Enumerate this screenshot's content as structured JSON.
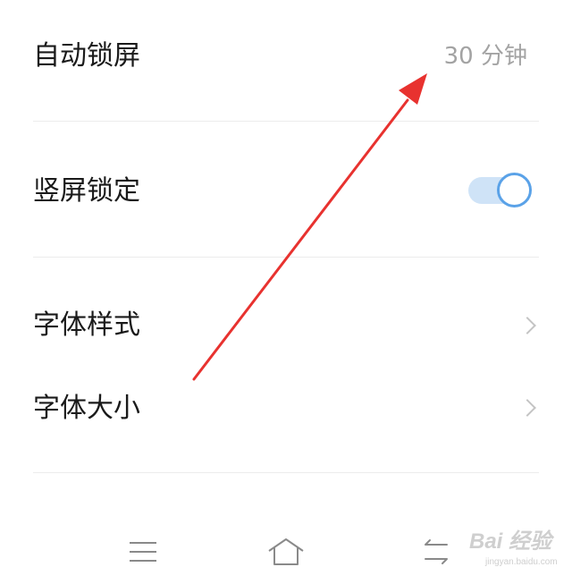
{
  "settings": {
    "auto_lock": {
      "label": "自动锁屏",
      "value": "30 分钟"
    },
    "portrait_lock": {
      "label": "竖屏锁定",
      "enabled": true
    },
    "font_style": {
      "label": "字体样式"
    },
    "font_size": {
      "label": "字体大小"
    }
  },
  "colors": {
    "toggle_accent": "#5aa2e8",
    "arrow": "#e8322f"
  },
  "navbar": {
    "icons": [
      "menu-icon",
      "home-icon",
      "back-icon"
    ]
  },
  "watermark": {
    "brand": "Bai 经验",
    "url": "jingyan.baidu.com"
  }
}
